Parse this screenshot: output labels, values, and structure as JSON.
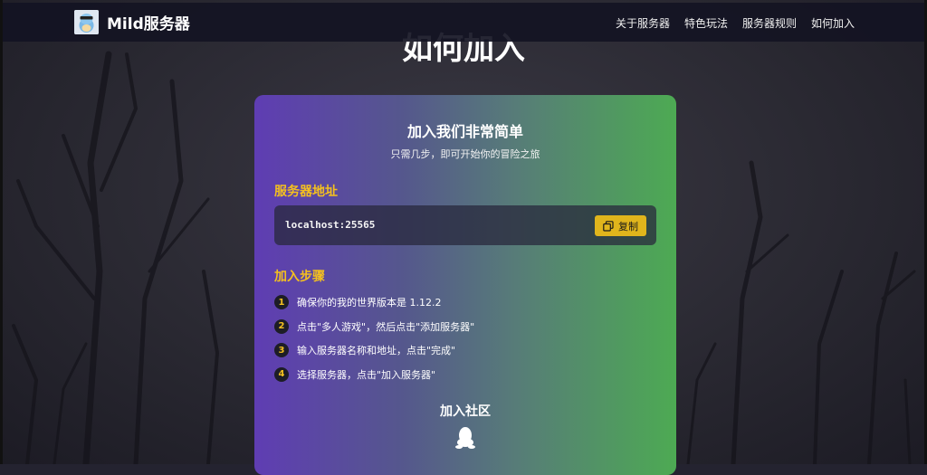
{
  "header": {
    "brand": "Mild服务器",
    "nav": [
      "关于服务器",
      "特色玩法",
      "服务器规则",
      "如何加入"
    ]
  },
  "section_title": "如何加入",
  "card": {
    "title": "加入我们非常简单",
    "subtitle": "只需几步，即可开始你的冒险之旅",
    "address_heading": "服务器地址",
    "address": "localhost:25565",
    "copy_label": "复制",
    "steps_heading": "加入步骤",
    "steps": [
      {
        "num": "1",
        "text": "确保你的我的世界版本是 1.12.2"
      },
      {
        "num": "2",
        "text": "点击\"多人游戏\"，然后点击\"添加服务器\""
      },
      {
        "num": "3",
        "text": "输入服务器名称和地址，点击\"完成\""
      },
      {
        "num": "4",
        "text": "选择服务器，点击\"加入服务器\""
      }
    ],
    "community_heading": "加入社区",
    "community_icon": "qq-icon"
  },
  "colors": {
    "accent": "#f4c01f",
    "navbar": "#14141f",
    "card_left": "#5f3db3",
    "card_right": "#4daa53",
    "copy_button": "#e0b51c"
  }
}
